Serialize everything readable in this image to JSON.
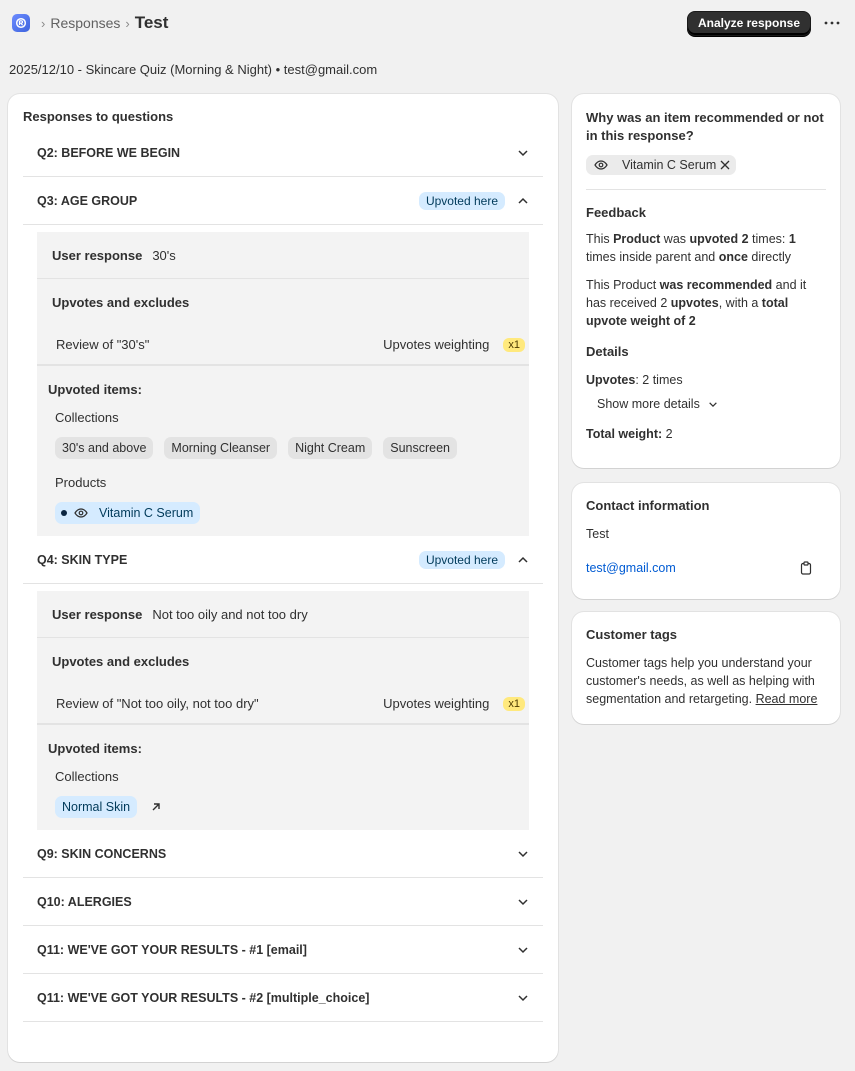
{
  "breadcrumb": {
    "parent": "Responses",
    "current": "Test"
  },
  "header": {
    "analyze_button": "Analyze response"
  },
  "meta_line": "2025/12/10 - Skincare Quiz (Morning & Night) • test@gmail.com",
  "left": {
    "title": "Responses to questions",
    "q2": "Q2: BEFORE WE BEGIN",
    "q3": {
      "title": "Q3: AGE GROUP",
      "badge": "Upvoted here",
      "user_response_label": "User response",
      "user_response_value": "30's",
      "upvotes_title": "Upvotes and excludes",
      "review": "Review of \"30's\"",
      "weighting_label": "Upvotes weighting",
      "weighting_value": "x1",
      "upvoted_items_label": "Upvoted items:",
      "collections_label": "Collections",
      "collections": [
        "30's and above",
        "Morning Cleanser",
        "Night Cream",
        "Sunscreen"
      ],
      "products_label": "Products",
      "product": "Vitamin C Serum"
    },
    "q4": {
      "title": "Q4: SKIN TYPE",
      "badge": "Upvoted here",
      "user_response_label": "User response",
      "user_response_value": "Not too oily and not too dry",
      "upvotes_title": "Upvotes and excludes",
      "review": "Review of \"Not too oily, not too dry\"",
      "weighting_label": "Upvotes weighting",
      "weighting_value": "x1",
      "upvoted_items_label": "Upvoted items:",
      "collections_label": "Collections",
      "collection": "Normal Skin"
    },
    "q9": "Q9: SKIN CONCERNS",
    "q10": "Q10: ALERGIES",
    "q11a": "Q11: WE'VE GOT YOUR RESULTS - #1 [email]",
    "q11b": "Q11: WE'VE GOT YOUR RESULTS - #2 [multiple_choice]"
  },
  "why": {
    "title": "Why was an item recommended or not in this response?",
    "chip": "Vitamin C Serum",
    "feedback_title": "Feedback",
    "fb1": {
      "a": "This ",
      "b": "Product",
      "c": " was ",
      "d": "upvoted 2",
      "e": " times: ",
      "f": "1",
      "g": " times inside parent and ",
      "h": "once",
      "i": " directly"
    },
    "fb2": {
      "a": "This Product ",
      "b": "was recommended",
      "c": " and it has received 2 ",
      "d": "upvotes",
      "e": ", with a ",
      "f": "total upvote weight of 2"
    },
    "details_title": "Details",
    "upvotes_label": "Upvotes",
    "upvotes_value": ": 2 times",
    "show_more": "Show more details",
    "total_label": "Total weight:",
    "total_value": " 2"
  },
  "contact": {
    "title": "Contact information",
    "name": "Test",
    "email": "test@gmail.com"
  },
  "tags": {
    "title": "Customer tags",
    "text": "Customer tags help you understand your customer's needs, as well as helping with segmentation and retargeting.",
    "read_more": "Read more"
  }
}
